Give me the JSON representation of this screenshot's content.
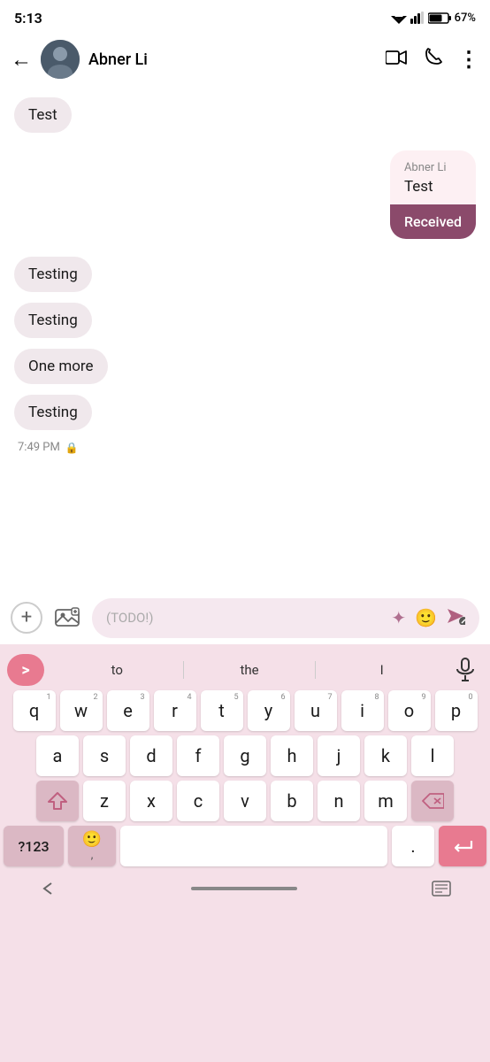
{
  "statusBar": {
    "time": "5:13",
    "battery": "67%"
  },
  "header": {
    "backLabel": "←",
    "contactName": "Abner Li",
    "videoIcon": "📹",
    "phoneIcon": "📞",
    "moreIcon": "⋮"
  },
  "chat": {
    "messages": [
      {
        "type": "left",
        "text": "Test"
      },
      {
        "type": "right",
        "sender": "Abner Li",
        "text": "Test",
        "status": "Received"
      },
      {
        "type": "left",
        "text": "Testing"
      },
      {
        "type": "left",
        "text": "Testing"
      },
      {
        "type": "left",
        "text": "One more"
      },
      {
        "type": "left",
        "text": "Testing"
      }
    ],
    "timestamp": "7:49 PM"
  },
  "inputBar": {
    "placeholder": "(TODO!)",
    "addIcon": "+",
    "galleryIcon": "🖼",
    "sparkleIcon": "✦",
    "emojiIcon": "🙂",
    "sendIcon": "➤"
  },
  "keyboard": {
    "suggestions": [
      "to",
      "the",
      "I"
    ],
    "rows": [
      [
        {
          "letter": "q",
          "num": "1"
        },
        {
          "letter": "w",
          "num": "2"
        },
        {
          "letter": "e",
          "num": "3"
        },
        {
          "letter": "r",
          "num": "4"
        },
        {
          "letter": "t",
          "num": "5"
        },
        {
          "letter": "y",
          "num": "6"
        },
        {
          "letter": "u",
          "num": "7"
        },
        {
          "letter": "i",
          "num": "8"
        },
        {
          "letter": "o",
          "num": "9"
        },
        {
          "letter": "p",
          "num": "0"
        }
      ],
      [
        {
          "letter": "a"
        },
        {
          "letter": "s"
        },
        {
          "letter": "d"
        },
        {
          "letter": "f"
        },
        {
          "letter": "g"
        },
        {
          "letter": "h"
        },
        {
          "letter": "j"
        },
        {
          "letter": "k"
        },
        {
          "letter": "l"
        }
      ],
      [
        {
          "letter": "z"
        },
        {
          "letter": "x"
        },
        {
          "letter": "c"
        },
        {
          "letter": "v"
        },
        {
          "letter": "b"
        },
        {
          "letter": "n"
        },
        {
          "letter": "m"
        }
      ]
    ],
    "numLabel": "?123",
    "emojiSmallIcon": "🙂",
    "commaLabel": ",",
    "periodLabel": ".",
    "enterIcon": "↵"
  }
}
